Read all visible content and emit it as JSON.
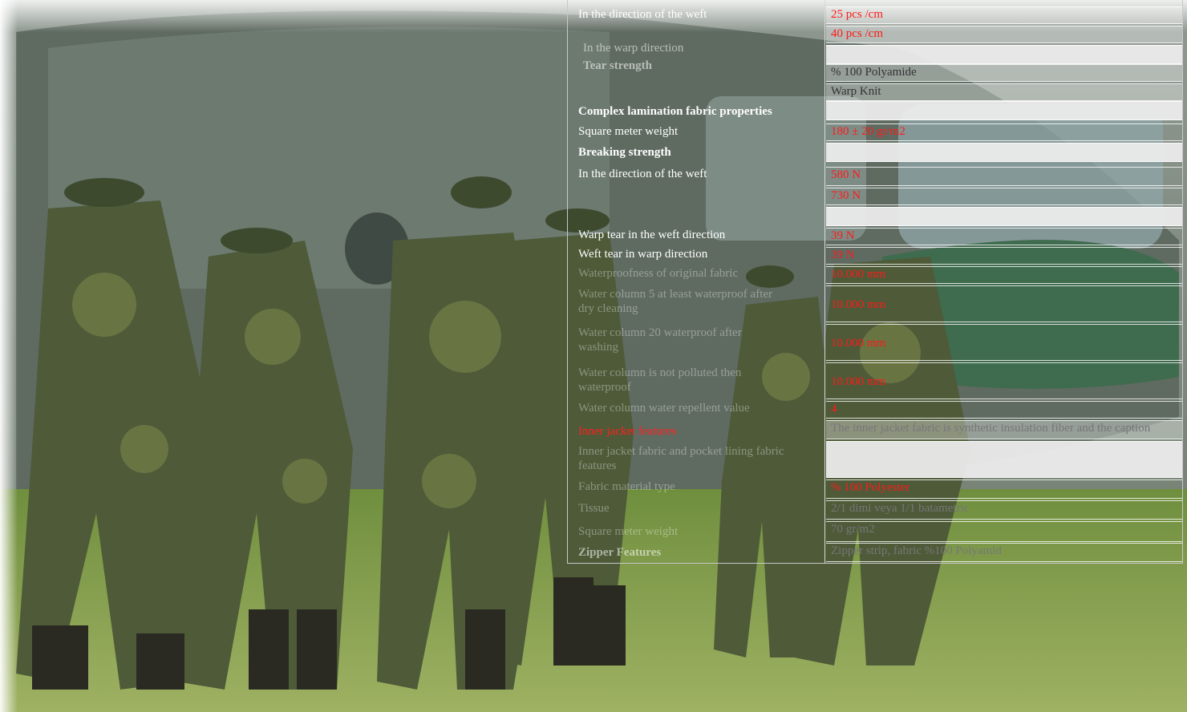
{
  "spec_table": {
    "rows": [
      {
        "label": "In the direction of the weft",
        "value": "25 pcs /cm"
      },
      {
        "label": "",
        "value": "40 pcs /cm"
      },
      {
        "label": "In the warp direction",
        "value": ""
      },
      {
        "label": "Tear strength",
        "value": "% 100 Polyamide"
      },
      {
        "label": "",
        "value": "Warp Knit"
      },
      {
        "label": "Complex lamination fabric properties",
        "value": ""
      },
      {
        "label": "Square meter weight",
        "value": "180 ± 20 gr/m2"
      },
      {
        "label": "Breaking strength",
        "value": ""
      },
      {
        "label": "In the direction of the weft",
        "value": "580 N"
      },
      {
        "label": "",
        "value": "730 N"
      },
      {
        "label": "",
        "value": ""
      },
      {
        "label": "Warp tear in the weft direction",
        "value": "39 N"
      },
      {
        "label": "Weft tear in warp direction",
        "value": "39 N"
      },
      {
        "label": "Waterproofness of original fabric",
        "value": "10.000 mm"
      },
      {
        "label": "Water column 5 at least waterproof after dry cleaning",
        "value": "10.000 mm"
      },
      {
        "label": "Water column 20 waterproof after washing",
        "value": "10.000 mm"
      },
      {
        "label": "Water column is not polluted then waterproof",
        "value": "10.000 mm"
      },
      {
        "label": "Water column water repellent value",
        "value": "4"
      },
      {
        "label": "Inner jacket features",
        "value": "The inner jacket fabric is synthetic insulation fiber and the caption"
      },
      {
        "label": "Inner jacket fabric and pocket lining fabric features",
        "value": ""
      },
      {
        "label": "Fabric material type",
        "value": "% 100 Polyester"
      },
      {
        "label": "Tissue",
        "value": "2/1 dimi veya 1/1 batametric"
      },
      {
        "label": "Square meter weight",
        "value": "70 gr/m2"
      },
      {
        "label": "Zipper Features",
        "value": "Zipper strip, fabric %100 Polyamid"
      }
    ]
  }
}
